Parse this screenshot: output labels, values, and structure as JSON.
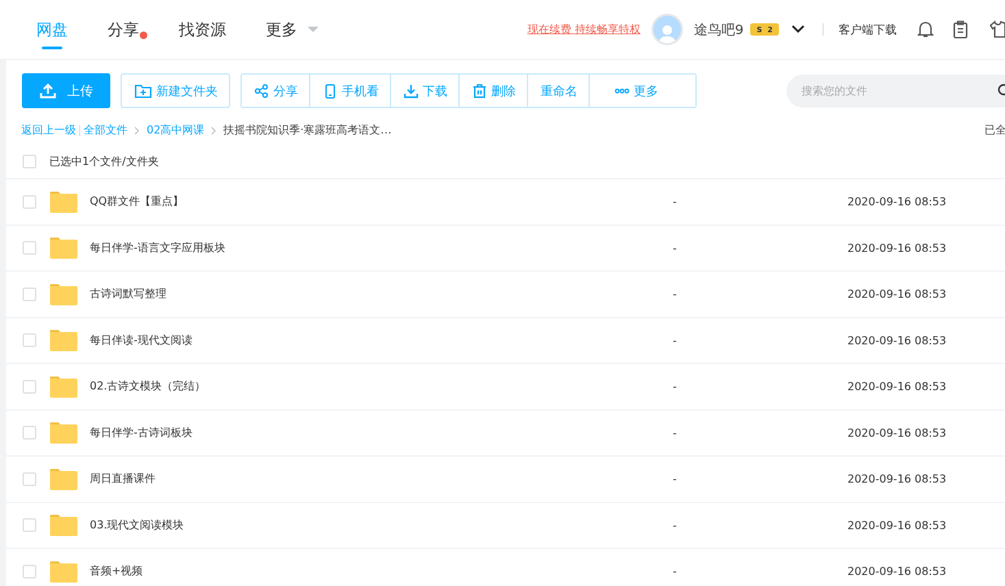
{
  "nav": {
    "tabs": [
      {
        "label": "网盘",
        "selected": true,
        "badge": false,
        "kind": "link"
      },
      {
        "label": "分享",
        "selected": false,
        "badge": true,
        "kind": "link"
      },
      {
        "label": "找资源",
        "selected": false,
        "badge": false,
        "kind": "link"
      },
      {
        "label": "更多",
        "selected": false,
        "badge": false,
        "kind": "menu"
      }
    ]
  },
  "user": {
    "renew_link": "现在续费 持续畅享特权",
    "name": "途鸟吧9",
    "badge_letter": "S",
    "badge_level": "2",
    "client_download": "客户端下载"
  },
  "toolbar": {
    "upload": "上传",
    "new_folder": "新建文件夹",
    "actions": [
      {
        "label": "分享",
        "kind": "share"
      },
      {
        "label": "手机看",
        "kind": "phone"
      },
      {
        "label": "下载",
        "kind": "download"
      },
      {
        "label": "删除",
        "kind": "delete"
      },
      {
        "label": "重命名",
        "kind": "text"
      },
      {
        "label": "更多",
        "kind": "more"
      }
    ],
    "search": {
      "placeholder": "搜索您的文件"
    }
  },
  "breadcrumb": {
    "back": "返回上一级",
    "items": [
      {
        "label": "全部文件",
        "kind": "link"
      },
      {
        "label": "02高中网课",
        "kind": "link"
      },
      {
        "label": "扶摇书院知识季·寒露班高考语文…",
        "kind": "current"
      }
    ],
    "status": "已全"
  },
  "list": {
    "header": {
      "checked": false,
      "label": "已选中1个文件/文件夹"
    },
    "rows": [
      {
        "name": "QQ群文件【重点】",
        "size": "-",
        "modified": "2020-09-16 08:53",
        "checked": false
      },
      {
        "name": "每日伴学-语言文字应用板块",
        "size": "-",
        "modified": "2020-09-16 08:53",
        "checked": false
      },
      {
        "name": "古诗词默写整理",
        "size": "-",
        "modified": "2020-09-16 08:53",
        "checked": false
      },
      {
        "name": "每日伴读-现代文阅读",
        "size": "-",
        "modified": "2020-09-16 08:53",
        "checked": false
      },
      {
        "name": "02.古诗文模块（完结）",
        "size": "-",
        "modified": "2020-09-16 08:53",
        "checked": false
      },
      {
        "name": "每日伴学-古诗词板块",
        "size": "-",
        "modified": "2020-09-16 08:53",
        "checked": false
      },
      {
        "name": "周日直播课件",
        "size": "-",
        "modified": "2020-09-16 08:53",
        "checked": false
      },
      {
        "name": "03.现代文阅读模块",
        "size": "-",
        "modified": "2020-09-16 08:53",
        "checked": false
      },
      {
        "name": "音频+视频",
        "size": "-",
        "modified": "2020-09-16 08:53",
        "checked": false
      }
    ]
  }
}
